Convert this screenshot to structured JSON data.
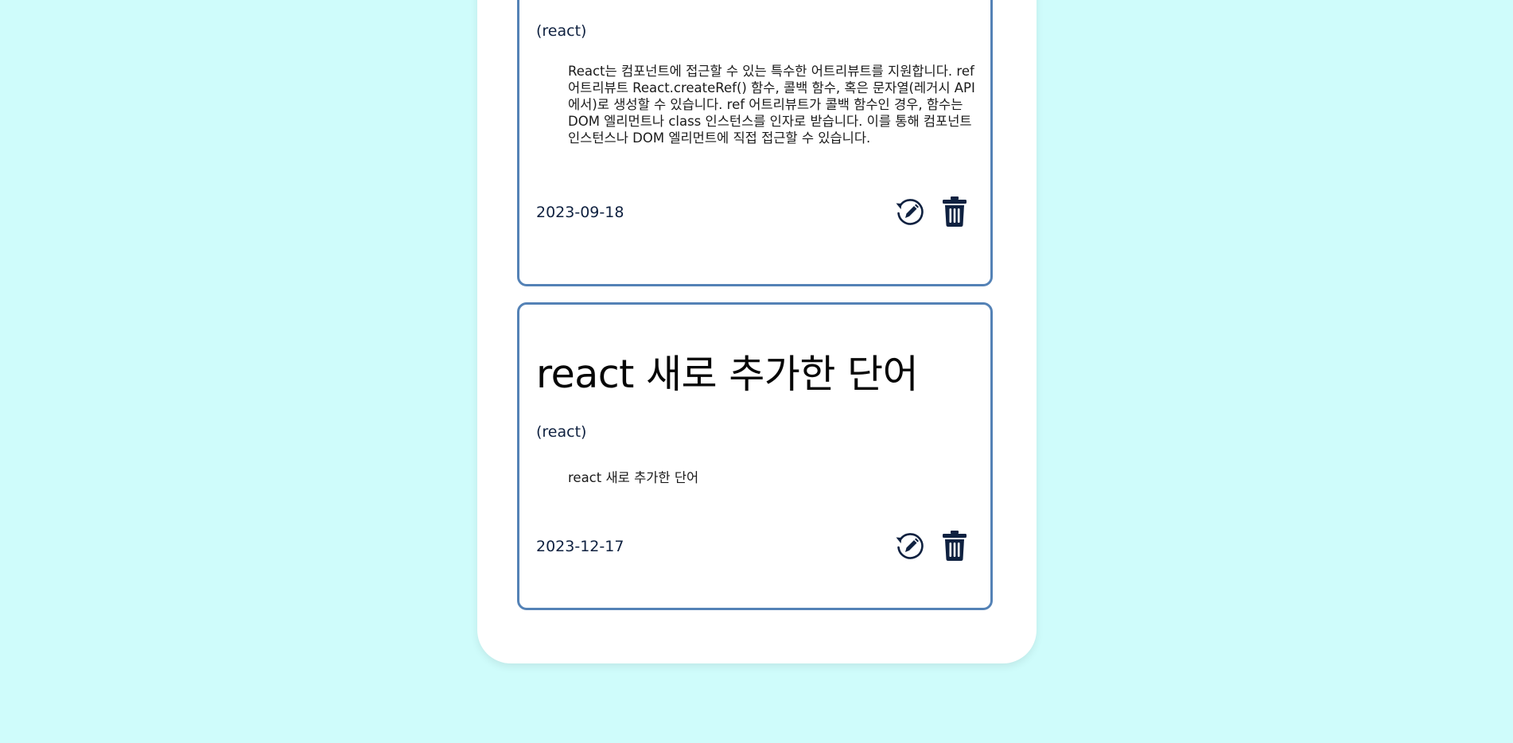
{
  "cards": [
    {
      "title": "",
      "tag": "(react)",
      "description": "React는 컴포넌트에 접근할 수 있는 특수한 어트리뷰트를 지원합니다. ref 어트리뷰트 React.createRef() 함수, 콜백 함수, 혹은 문자열(레거시 API에서)로 생성할 수 있습니다. ref 어트리뷰트가 콜백 함수인 경우, 함수는 DOM 엘리먼트나 class 인스턴스를 인자로 받습니다. 이를 통해 컴포넌트 인스턴스나 DOM 엘리먼트에 직접 접근할 수 있습니다.",
      "date": "2023-09-18",
      "edit_icon": "edit-refresh-icon",
      "delete_icon": "trash-icon"
    },
    {
      "title": "react 새로 추가한 단어",
      "tag": "(react)",
      "description": "react 새로 추가한 단어",
      "date": "2023-12-17",
      "edit_icon": "edit-refresh-icon",
      "delete_icon": "trash-icon"
    }
  ],
  "colors": {
    "page_background": "#cffcfb",
    "panel_background": "#ffffff",
    "card_border": "#5482b6",
    "icon": "#0f2140"
  }
}
